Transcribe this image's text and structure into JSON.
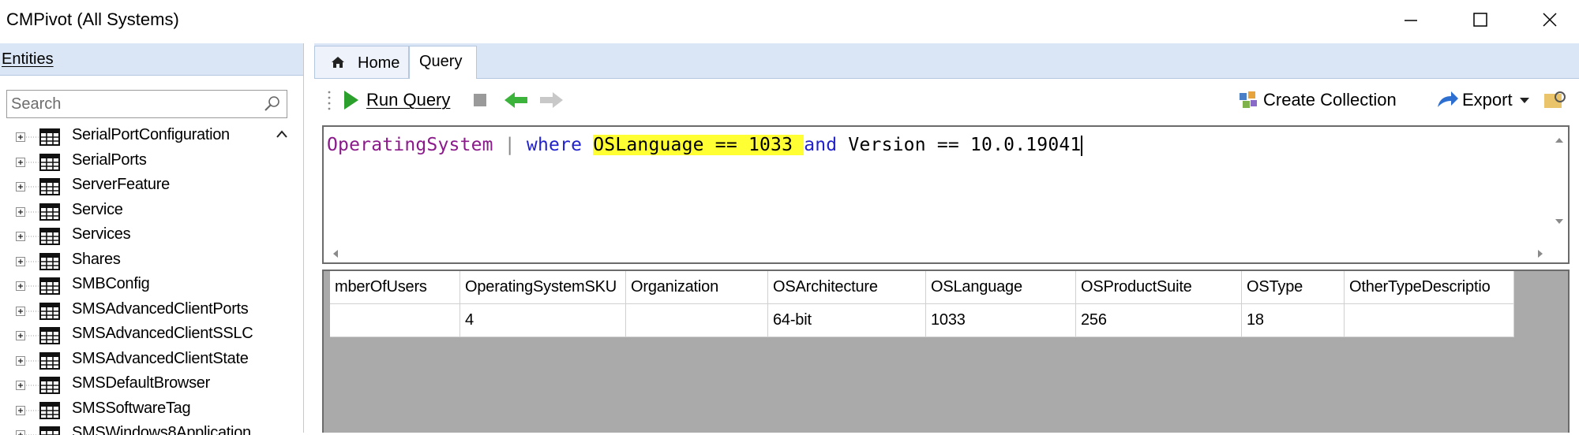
{
  "window": {
    "title": "CMPivot (All Systems)",
    "minimize": "—",
    "maximize": "☐",
    "close": "✕"
  },
  "entities": {
    "header": "Entities",
    "search_placeholder": "Search",
    "items": [
      "SerialPortConfiguration",
      "SerialPorts",
      "ServerFeature",
      "Service",
      "Services",
      "Shares",
      "SMBConfig",
      "SMSAdvancedClientPorts",
      "SMSAdvancedClientSSLC",
      "SMSAdvancedClientState",
      "SMSDefaultBrowser",
      "SMSSoftwareTag",
      "SMSWindows8Application"
    ]
  },
  "tabs": {
    "home": "Home",
    "query": "Query"
  },
  "toolbar": {
    "run_query": "Run Query",
    "create_collection": "Create Collection",
    "export": "Export"
  },
  "query": {
    "entity": "OperatingSystem",
    "pipe": "|",
    "where": "where",
    "field1": "OSLanguage",
    "op1": "==",
    "value1": "1033",
    "and": "and",
    "field2": "Version",
    "op2": "==",
    "value2": "10.0.19041"
  },
  "grid": {
    "columns": [
      "mberOfUsers",
      "OperatingSystemSKU",
      "Organization",
      "OSArchitecture",
      "OSLanguage",
      "OSProductSuite",
      "OSType",
      "OtherTypeDescriptio"
    ],
    "rows": [
      [
        "",
        "4",
        "",
        "64-bit",
        "1033",
        "256",
        "18",
        ""
      ]
    ]
  },
  "colors": {
    "highlight": "#ffff33",
    "header_blue": "#dae6f6",
    "run_green": "#2ca02c"
  }
}
